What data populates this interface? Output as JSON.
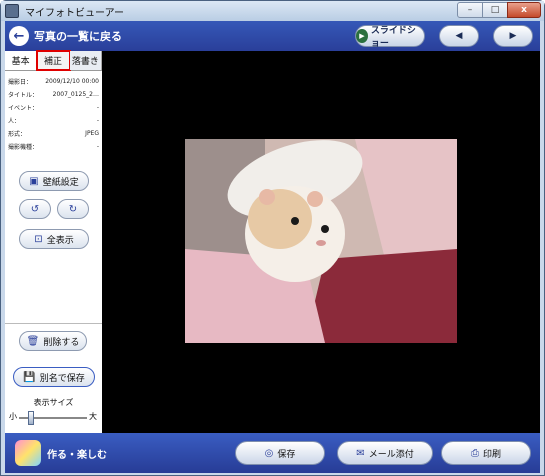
{
  "window": {
    "title": "マイフォトビューアー"
  },
  "window_controls": {
    "minimize": "–",
    "maximize": "□",
    "close": "x"
  },
  "top": {
    "back_label": "写真の一覧に戻る",
    "slideshow": "スライドショー",
    "prev": "◀",
    "next": "▶"
  },
  "tabs": [
    {
      "label": "基本"
    },
    {
      "label": "補正"
    },
    {
      "label": "落書き"
    }
  ],
  "info": [
    {
      "k": "撮影日：",
      "v": "2009/12/10 00:00"
    },
    {
      "k": "タイトル：",
      "v": "2007_0125_2…"
    },
    {
      "k": "イベント：",
      "v": "-"
    },
    {
      "k": "人：",
      "v": "-"
    },
    {
      "k": "形式：",
      "v": "JPEG"
    },
    {
      "k": "撮影機種：",
      "v": "-"
    }
  ],
  "side": {
    "wallpaper": "壁紙設定",
    "fit": "全表示",
    "delete": "削除する",
    "save_as": "別名で保存",
    "size_label": "表示サイズ",
    "size_small": "小",
    "size_large": "大",
    "size_level": 0.15
  },
  "bottom": {
    "make_label": "作る・楽しむ",
    "save": "保存",
    "mail": "メール添付",
    "print": "印刷"
  }
}
